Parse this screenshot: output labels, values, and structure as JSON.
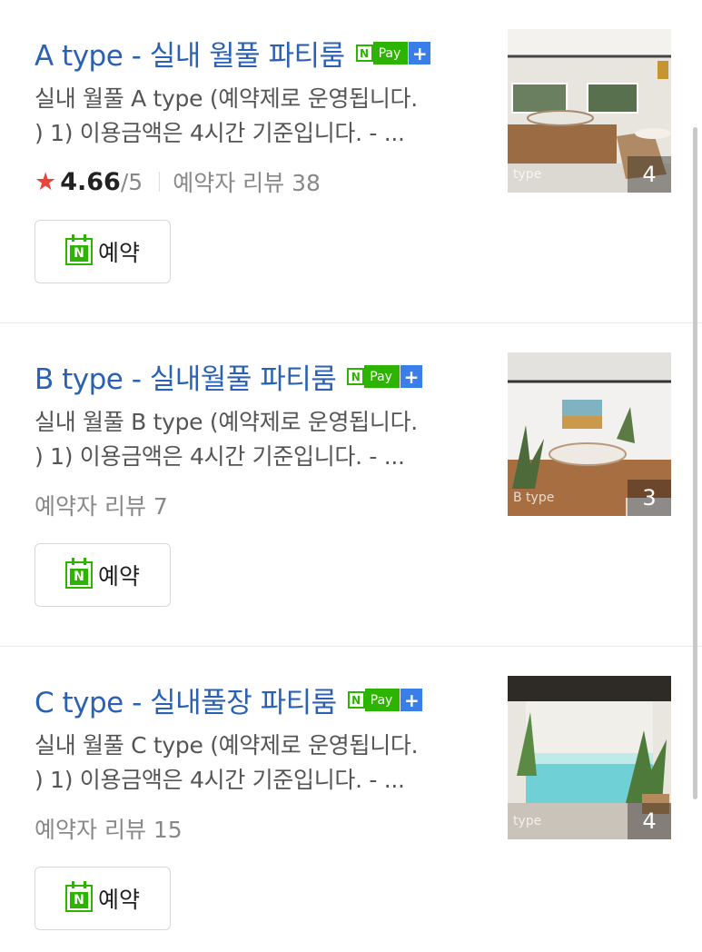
{
  "items": [
    {
      "title": "A type - 실내 월풀 파티룸",
      "npay": {
        "n": "N",
        "pay": "Pay",
        "plus": "+"
      },
      "desc_line1": "실내 월풀 A type (예약제로 운영됩니다.",
      "desc_line2": ") 1) 이용금액은 4시간 기준입니다. - ...",
      "has_rating": true,
      "rating_star": "★",
      "rating": "4.66",
      "rating_max": "/5",
      "reviews": "예약자 리뷰 38",
      "reserve_label": "예약",
      "reserve_icon_letter": "N",
      "photo_tag": "type",
      "photo_count": "4",
      "photo_icon": "room-photo-icon"
    },
    {
      "title": "B type - 실내월풀 파티룸",
      "npay": {
        "n": "N",
        "pay": "Pay",
        "plus": "+"
      },
      "desc_line1": "실내 월풀 B type (예약제로 운영됩니다.",
      "desc_line2": ") 1) 이용금액은 4시간 기준입니다. - ...",
      "has_rating": false,
      "reviews": "예약자 리뷰 7",
      "reserve_label": "예약",
      "reserve_icon_letter": "N",
      "photo_tag": "B type",
      "photo_count": "3",
      "photo_icon": "room-photo-icon"
    },
    {
      "title": "C type - 실내풀장 파티룸",
      "npay": {
        "n": "N",
        "pay": "Pay",
        "plus": "+"
      },
      "desc_line1": "실내 월풀 C type (예약제로 운영됩니다.",
      "desc_line2": ") 1) 이용금액은 4시간 기준입니다. - ...",
      "has_rating": false,
      "reviews": "예약자 리뷰 15",
      "reserve_label": "예약",
      "reserve_icon_letter": "N",
      "photo_tag": "type",
      "photo_count": "4",
      "photo_icon": "room-photo-icon"
    }
  ],
  "colors": {
    "title": "#2a61b4",
    "naver_green": "#2db400",
    "plus_blue": "#3a7ee8",
    "star_red": "#e8443a"
  }
}
